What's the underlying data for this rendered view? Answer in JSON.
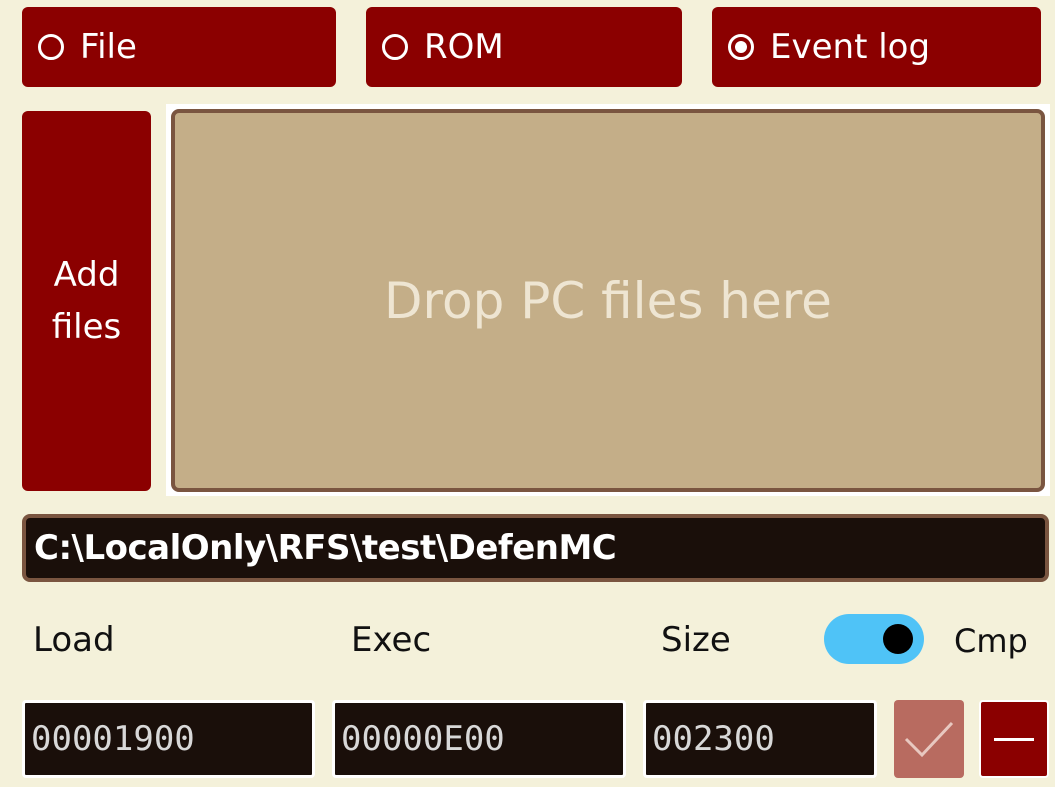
{
  "modes": {
    "file": {
      "label": "File",
      "selected": false
    },
    "rom": {
      "label": "ROM",
      "selected": false
    },
    "event_log": {
      "label": "Event log",
      "selected": true
    }
  },
  "add_files": {
    "line1": "Add",
    "line2": "files"
  },
  "drop_zone": {
    "text": "Drop PC files here"
  },
  "path": {
    "value": "C:\\LocalOnly\\RFS\\test\\DefenMC"
  },
  "fields": {
    "load_label": "Load",
    "exec_label": "Exec",
    "size_label": "Size",
    "cmp_label": "Cmp",
    "load_value": "00001900",
    "exec_value": "00000E00",
    "size_value": "002300"
  },
  "cmp_toggle": {
    "on": true
  },
  "icons": {
    "radio_empty": "radio-unchecked-icon",
    "radio_checked": "radio-checked-icon",
    "confirm": "checkmark-icon",
    "remove": "minus-icon"
  },
  "colors": {
    "background": "#f4f1da",
    "button": "#8b0000",
    "drop_zone": "#c4ae88",
    "field_bg": "#1a0f0a",
    "toggle_on": "#4fc3f7",
    "confirm_disabled": "#b86b60"
  }
}
